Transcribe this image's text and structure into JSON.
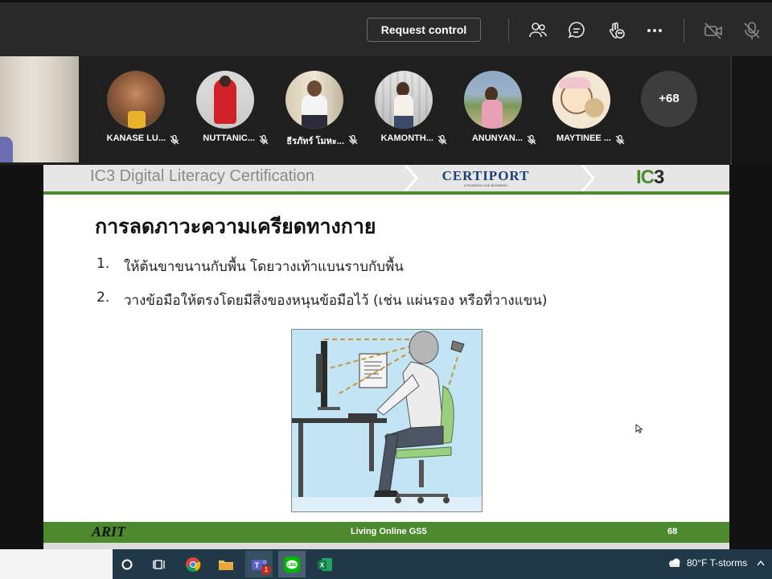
{
  "toolbar": {
    "request_control_label": "Request control",
    "icons": [
      "people-icon",
      "chat-icon",
      "reactions-icon",
      "more-options-icon",
      "camera-off-icon",
      "mic-off-icon"
    ]
  },
  "participants": [
    {
      "name": "KANASE LU...",
      "muted": true
    },
    {
      "name": "NUTTANIC...",
      "muted": true
    },
    {
      "name": "ธีรภัทร์ โมหะ...",
      "muted": true
    },
    {
      "name": "KAMONTH...",
      "muted": true
    },
    {
      "name": "ANUNYAN...",
      "muted": true
    },
    {
      "name": "MAYTINEE ...",
      "muted": true
    }
  ],
  "more_participants": "+68",
  "slide": {
    "header_title": "IC3 Digital Literacy Certification",
    "certiport_logo": "CERTIPORT",
    "certiport_sub": "A PEARSON VUE BUSINESS",
    "ic3_logo_a": "IC",
    "ic3_logo_b": "3",
    "title": "การลดภาวะความเครียดทางกาย",
    "items": [
      {
        "num": "1.",
        "text": "ให้ต้นขาขนานกับพื้น โดยวางเท้าแบนราบกับพื้น"
      },
      {
        "num": "2.",
        "text": "วางข้อมือให้ตรงโดยมีสิ่งของหนุนข้อมือไว้ (เช่น แผ่นรอง หรือที่วางแขน)"
      }
    ],
    "footer_logo": "ARIT",
    "footer_center": "Living Online GS5",
    "page_number": "68"
  },
  "taskbar": {
    "apps": [
      "cortana-icon",
      "task-view-icon",
      "chrome-icon",
      "file-explorer-icon",
      "teams-icon",
      "line-icon",
      "excel-icon"
    ],
    "teams_badge": "1",
    "weather": "80°F  T-storms"
  },
  "colors": {
    "slide_green": "#4d8a2e",
    "toolbar_bg": "#292929",
    "taskbar_bg": "#203848"
  }
}
